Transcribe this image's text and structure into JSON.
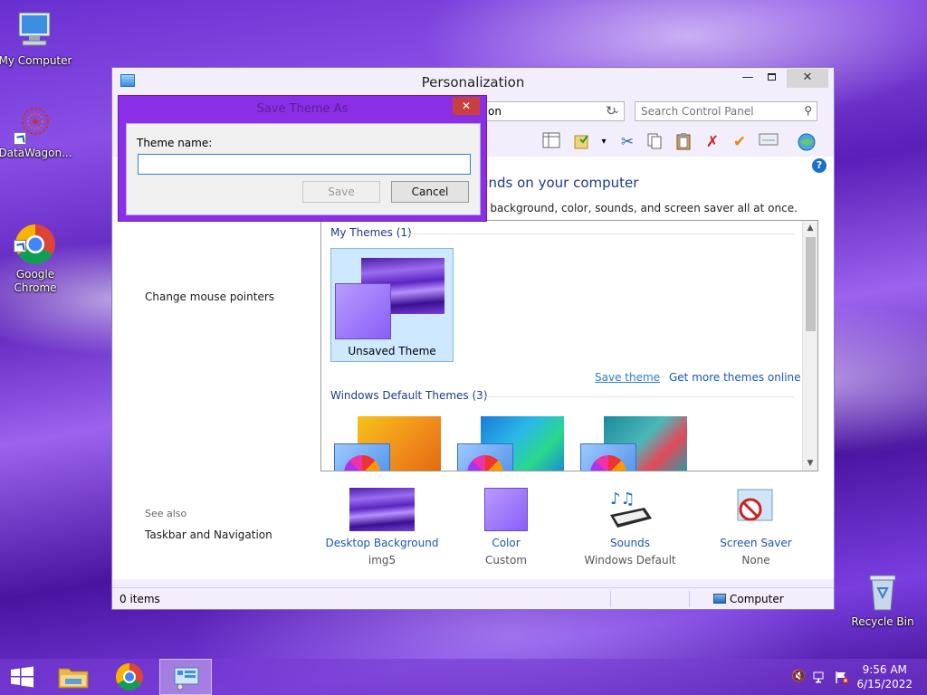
{
  "desktop": {
    "icons": [
      {
        "label": "My Computer"
      },
      {
        "label": "DataWagon..."
      },
      {
        "label": "Google\nChrome"
      },
      {
        "label": "Recycle Bin"
      }
    ]
  },
  "window": {
    "title": "Personalization",
    "address_text": "on",
    "search_placeholder": "Search Control Panel",
    "heading": "unds on your computer",
    "subheading": "p background, color, sounds, and screen saver all at once.",
    "left_links": [
      "Change mouse pointers"
    ],
    "see_also_label": "See also",
    "see_also_links": [
      "Taskbar and Navigation"
    ],
    "help_glyph": "?",
    "themes": {
      "my_group": "My Themes (1)",
      "unsaved_name": "Unsaved Theme",
      "save_link": "Save theme",
      "more_link": "Get more themes online",
      "default_group": "Windows Default Themes (3)"
    },
    "bottom_items": [
      {
        "label": "Desktop Background",
        "value": "img5"
      },
      {
        "label": "Color",
        "value": "Custom"
      },
      {
        "label": "Sounds",
        "value": "Windows Default"
      },
      {
        "label": "Screen Saver",
        "value": "None"
      }
    ],
    "status": {
      "left": "0 items",
      "right": "Computer"
    }
  },
  "dialog": {
    "title": "Save Theme As",
    "field_label": "Theme name:",
    "field_value": "",
    "save_label": "Save",
    "cancel_label": "Cancel",
    "close_glyph": "✕"
  },
  "taskbar": {
    "time": "9:56 AM",
    "date": "6/15/2022"
  }
}
